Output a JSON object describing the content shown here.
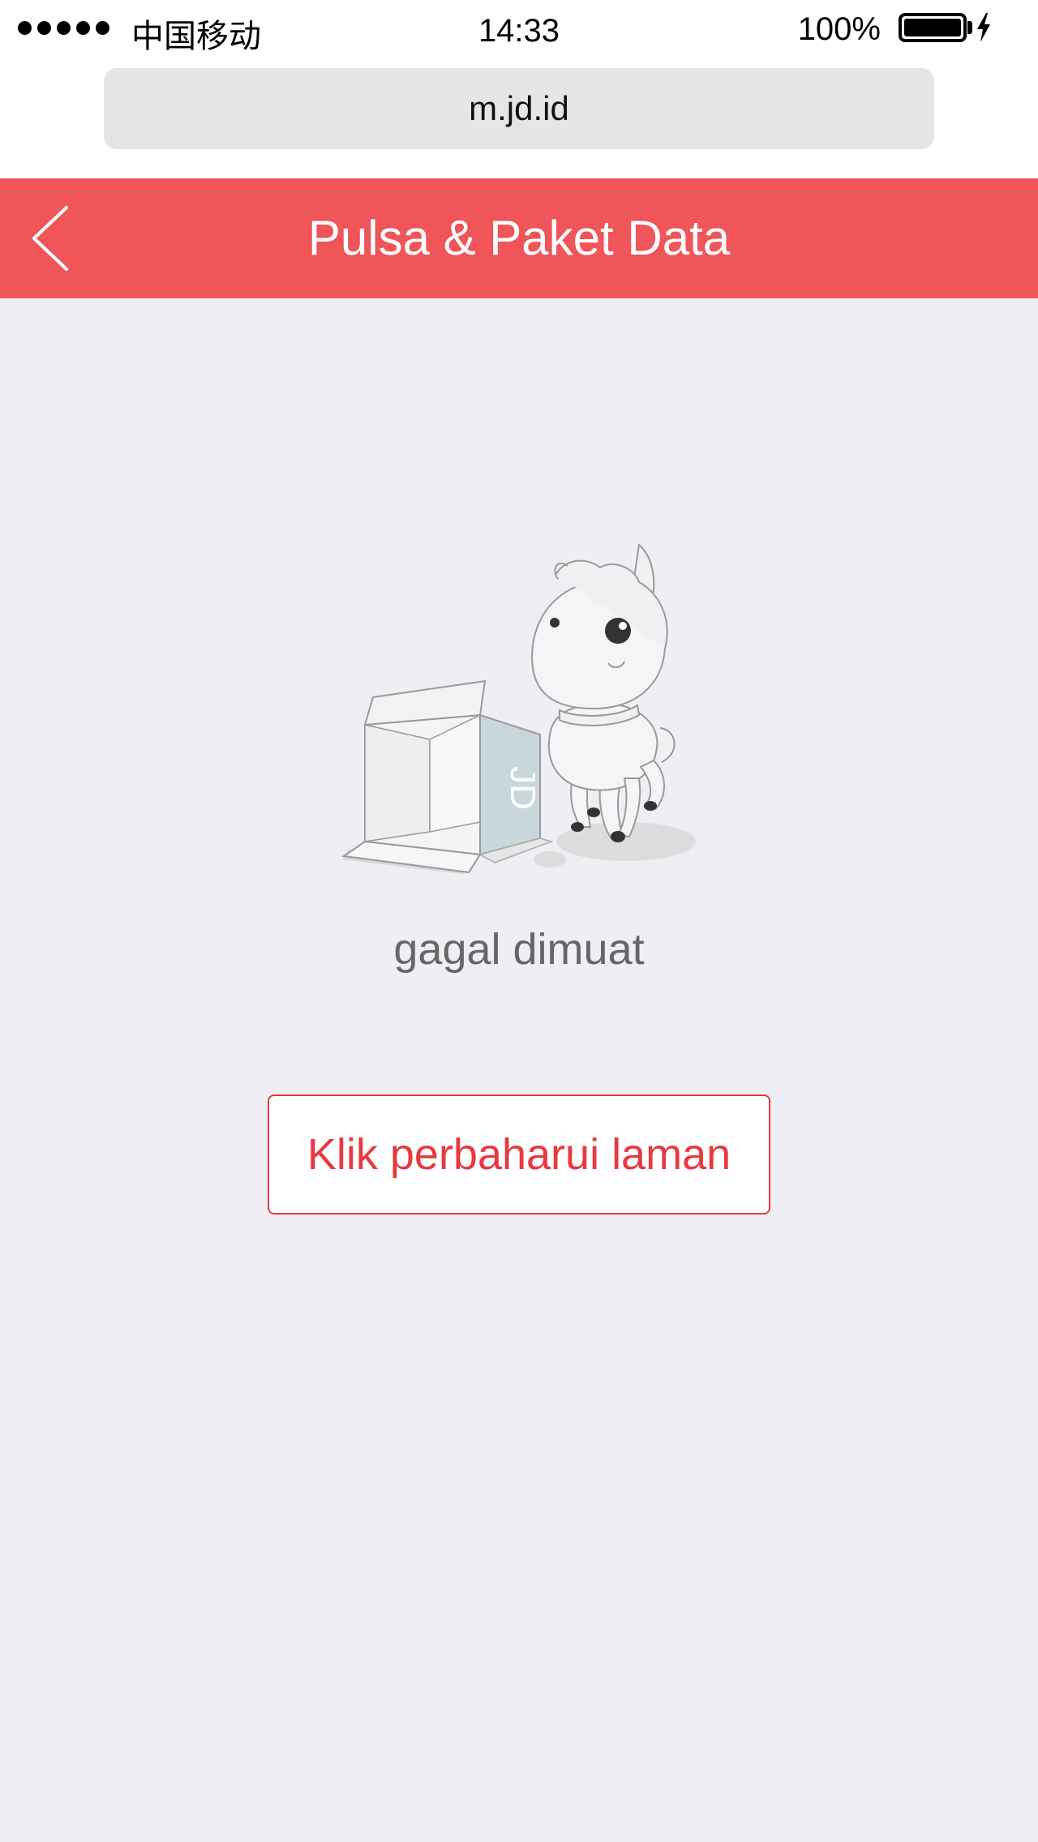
{
  "status_bar": {
    "carrier": "中国移动",
    "time": "14:33",
    "battery_percent": "100%"
  },
  "browser": {
    "url": "m.jd.id"
  },
  "header": {
    "title": "Pulsa & Paket Data",
    "background_color": "#ef5559"
  },
  "main": {
    "box_label": "JD",
    "error_message": "gagal dimuat",
    "refresh_button_label": "Klik perbaharui laman",
    "accent_color": "#e63a40"
  }
}
